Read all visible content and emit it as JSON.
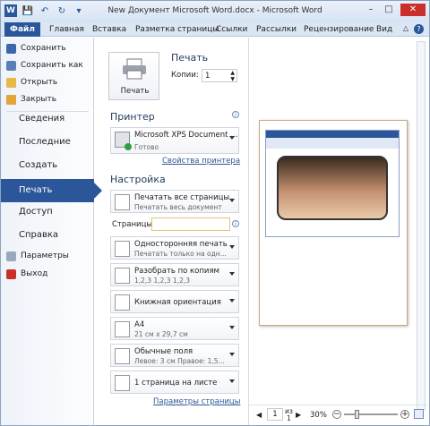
{
  "title": "New Документ Microsoft Word.docx - Microsoft Word",
  "ribbon_tabs": [
    "Файл",
    "Главная",
    "Вставка",
    "Разметка страницы",
    "Ссылки",
    "Рассылки",
    "Рецензирование",
    "Вид"
  ],
  "left_menu": {
    "commands": [
      "Сохранить",
      "Сохранить как",
      "Открыть",
      "Закрыть"
    ],
    "sections": [
      "Сведения",
      "Последние",
      "Создать",
      "Печать",
      "Доступ",
      "Справка"
    ],
    "footer": [
      "Параметры",
      "Выход"
    ]
  },
  "print": {
    "header": "Печать",
    "button_label": "Печать",
    "copies_label": "Копии:",
    "copies_value": "1"
  },
  "printer": {
    "header": "Принтер",
    "name": "Microsoft XPS Document ...",
    "status": "Готово",
    "properties_link": "Свойства принтера"
  },
  "settings": {
    "header": "Настройка",
    "pages_label": "Страницы:",
    "pages_value": "",
    "options": [
      {
        "title": "Печатать все страницы",
        "subtitle": "Печатать весь документ"
      },
      {
        "title": "Односторонняя печать",
        "subtitle": "Печатать только на одн..."
      },
      {
        "title": "Разобрать по копиям",
        "subtitle": "1,2,3    1,2,3    1,2,3"
      },
      {
        "title": "Книжная ориентация",
        "subtitle": ""
      },
      {
        "title": "A4",
        "subtitle": "21 см x 29,7 см"
      },
      {
        "title": "Обычные поля",
        "subtitle": "Левое: 3 см    Правое: 1,5..."
      },
      {
        "title": "1 страница на листе",
        "subtitle": ""
      }
    ],
    "page_setup_link": "Параметры страницы"
  },
  "preview": {
    "page_current": "1",
    "page_of": "из",
    "page_total": "1",
    "zoom": "30%"
  },
  "colors": {
    "accent": "#2b579a",
    "close": "#c9302c"
  }
}
